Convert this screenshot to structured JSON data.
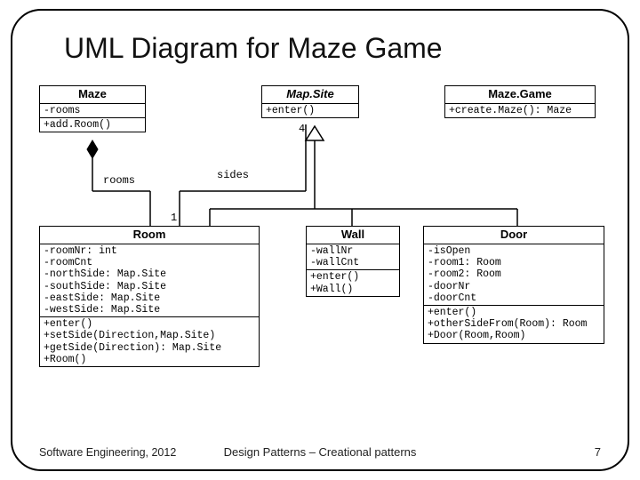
{
  "title": "UML Diagram for Maze Game",
  "footer": {
    "left": "Software Engineering, 2012",
    "center": "Design Patterns – Creational patterns",
    "right": "7"
  },
  "labels": {
    "rooms": "rooms",
    "sides": "sides",
    "mult4": "4",
    "mult1": "1"
  },
  "classes": {
    "maze": {
      "name": "Maze",
      "attrs": [
        "-rooms"
      ],
      "ops": [
        "+add.Room()"
      ]
    },
    "mapsite": {
      "name": "Map.Site",
      "ops": [
        "+enter()"
      ]
    },
    "mazegame": {
      "name": "Maze.Game",
      "ops": [
        "+create.Maze(): Maze"
      ]
    },
    "room": {
      "name": "Room",
      "attrs": [
        "-roomNr: int",
        "-roomCnt",
        "-northSide: Map.Site",
        "-southSide: Map.Site",
        "-eastSide: Map.Site",
        "-westSide: Map.Site"
      ],
      "ops": [
        "+enter()",
        "+setSide(Direction,Map.Site)",
        "+getSide(Direction): Map.Site",
        "+Room()"
      ]
    },
    "wall": {
      "name": "Wall",
      "attrs": [
        "-wallNr",
        "-wallCnt"
      ],
      "ops": [
        "+enter()",
        "+Wall()"
      ]
    },
    "door": {
      "name": "Door",
      "attrs": [
        "-isOpen",
        "-room1: Room",
        "-room2: Room",
        "-doorNr",
        "-doorCnt"
      ],
      "ops": [
        "+enter()",
        "+otherSideFrom(Room): Room",
        "+Door(Room,Room)"
      ]
    }
  }
}
